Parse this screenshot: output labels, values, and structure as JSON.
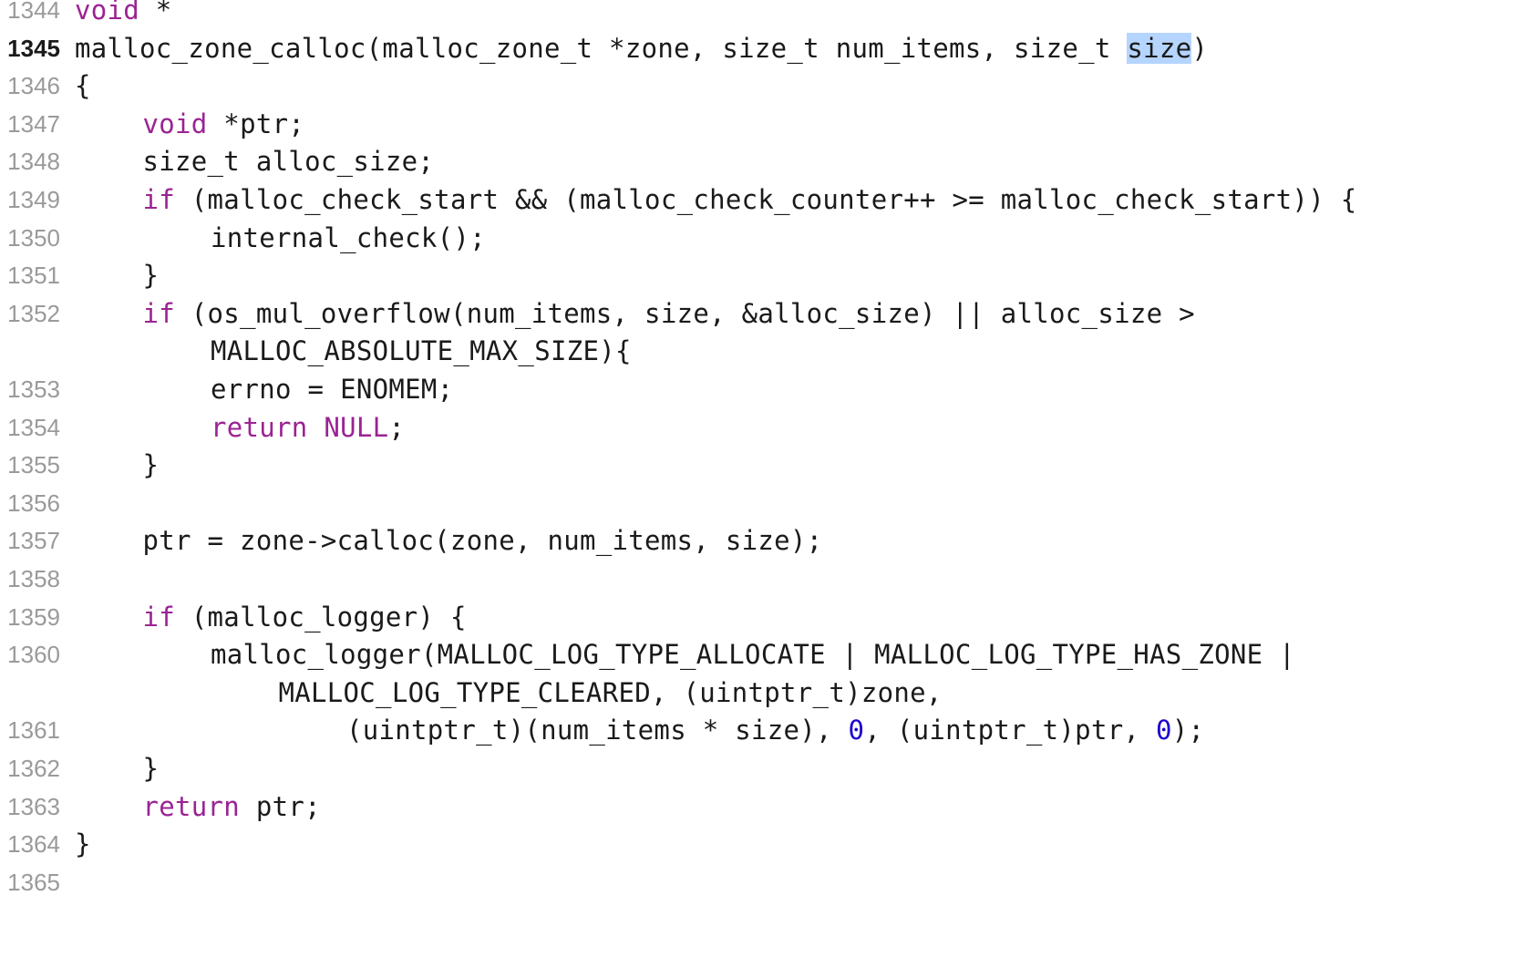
{
  "editor": {
    "lines": [
      {
        "no": "1344",
        "current": false,
        "indent": 0,
        "tokens": [
          {
            "t": "void",
            "c": "kw"
          },
          {
            "t": " *",
            "c": "pl"
          }
        ]
      },
      {
        "no": "1345",
        "current": true,
        "indent": 0,
        "tokens": [
          {
            "t": "malloc_zone_calloc(malloc_zone_t *zone, size_t num_items, size_t ",
            "c": "pl"
          },
          {
            "t": "size",
            "c": "sel"
          },
          {
            "t": ")",
            "c": "pl"
          }
        ]
      },
      {
        "no": "1346",
        "current": false,
        "indent": 0,
        "tokens": [
          {
            "t": "{",
            "c": "pl"
          }
        ]
      },
      {
        "no": "1347",
        "current": false,
        "indent": 1,
        "tokens": [
          {
            "t": "void",
            "c": "kw"
          },
          {
            "t": " *ptr;",
            "c": "pl"
          }
        ]
      },
      {
        "no": "1348",
        "current": false,
        "indent": 1,
        "tokens": [
          {
            "t": "size_t alloc_size;",
            "c": "pl"
          }
        ]
      },
      {
        "no": "1349",
        "current": false,
        "indent": 1,
        "tokens": [
          {
            "t": "if",
            "c": "kw"
          },
          {
            "t": " (malloc_check_start && (malloc_check_counter++ >= malloc_check_start)) {",
            "c": "pl"
          }
        ]
      },
      {
        "no": "1350",
        "current": false,
        "indent": 2,
        "tokens": [
          {
            "t": "internal_check();",
            "c": "pl"
          }
        ]
      },
      {
        "no": "1351",
        "current": false,
        "indent": 1,
        "tokens": [
          {
            "t": "}",
            "c": "pl"
          }
        ]
      },
      {
        "no": "1352",
        "current": false,
        "indent": 1,
        "tokens": [
          {
            "t": "if",
            "c": "kw"
          },
          {
            "t": " (os_mul_overflow(num_items, size, &alloc_size) || alloc_size >",
            "c": "pl"
          }
        ]
      },
      {
        "no": "",
        "current": false,
        "indent": 2,
        "tokens": [
          {
            "t": "MALLOC_ABSOLUTE_MAX_SIZE){",
            "c": "pl"
          }
        ]
      },
      {
        "no": "1353",
        "current": false,
        "indent": 2,
        "tokens": [
          {
            "t": "errno = ENOMEM;",
            "c": "pl"
          }
        ]
      },
      {
        "no": "1354",
        "current": false,
        "indent": 2,
        "tokens": [
          {
            "t": "return",
            "c": "kw"
          },
          {
            "t": " ",
            "c": "pl"
          },
          {
            "t": "NULL",
            "c": "kw"
          },
          {
            "t": ";",
            "c": "pl"
          }
        ]
      },
      {
        "no": "1355",
        "current": false,
        "indent": 1,
        "tokens": [
          {
            "t": "}",
            "c": "pl"
          }
        ]
      },
      {
        "no": "1356",
        "current": false,
        "indent": 0,
        "tokens": []
      },
      {
        "no": "1357",
        "current": false,
        "indent": 1,
        "tokens": [
          {
            "t": "ptr = zone->calloc(zone, num_items, size);",
            "c": "pl"
          }
        ]
      },
      {
        "no": "1358",
        "current": false,
        "indent": 0,
        "tokens": []
      },
      {
        "no": "1359",
        "current": false,
        "indent": 1,
        "tokens": [
          {
            "t": "if",
            "c": "kw"
          },
          {
            "t": " (malloc_logger) {",
            "c": "pl"
          }
        ]
      },
      {
        "no": "1360",
        "current": false,
        "indent": 2,
        "tokens": [
          {
            "t": "malloc_logger(MALLOC_LOG_TYPE_ALLOCATE | MALLOC_LOG_TYPE_HAS_ZONE |",
            "c": "pl"
          }
        ]
      },
      {
        "no": "",
        "current": false,
        "indent": 3,
        "tokens": [
          {
            "t": "MALLOC_LOG_TYPE_CLEARED, (uintptr_t)zone,",
            "c": "pl"
          }
        ]
      },
      {
        "no": "1361",
        "current": false,
        "indent": 4,
        "tokens": [
          {
            "t": "(uintptr_t)(num_items * size), ",
            "c": "pl"
          },
          {
            "t": "0",
            "c": "num"
          },
          {
            "t": ", (uintptr_t)ptr, ",
            "c": "pl"
          },
          {
            "t": "0",
            "c": "num"
          },
          {
            "t": ");",
            "c": "pl"
          }
        ]
      },
      {
        "no": "1362",
        "current": false,
        "indent": 1,
        "tokens": [
          {
            "t": "}",
            "c": "pl"
          }
        ]
      },
      {
        "no": "1363",
        "current": false,
        "indent": 1,
        "tokens": [
          {
            "t": "return",
            "c": "kw"
          },
          {
            "t": " ptr;",
            "c": "pl"
          }
        ]
      },
      {
        "no": "1364",
        "current": false,
        "indent": 0,
        "tokens": [
          {
            "t": "}",
            "c": "pl"
          }
        ]
      },
      {
        "no": "1365",
        "current": false,
        "indent": 0,
        "tokens": []
      }
    ],
    "colors": {
      "keyword": "#9b2393",
      "number": "#1c00cf",
      "selection": "#b5d5ff",
      "text": "#1a1a1a",
      "gutter": "#9a9a9a"
    }
  }
}
